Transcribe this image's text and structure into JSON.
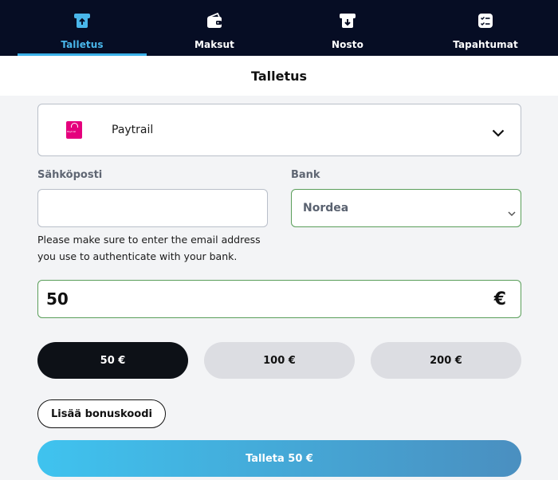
{
  "nav": {
    "tabs": [
      {
        "label": "Talletus",
        "icon": "deposit-icon",
        "active": true
      },
      {
        "label": "Maksut",
        "icon": "wallet-icon",
        "active": false
      },
      {
        "label": "Nosto",
        "icon": "withdraw-icon",
        "active": false
      },
      {
        "label": "Tapahtumat",
        "icon": "transactions-icon",
        "active": false
      }
    ]
  },
  "page": {
    "title": "Talletus"
  },
  "payment_method": {
    "name": "Paytrail",
    "logo_text": "Paytrail",
    "icon": "paytrail-logo"
  },
  "form": {
    "email_label": "Sähköposti",
    "email_value": "",
    "email_placeholder": "",
    "bank_label": "Bank",
    "bank_value": "Nordea",
    "hint": "Please make sure to enter the email address you use to authenticate with your bank.",
    "amount_value": "50",
    "currency_symbol": "€"
  },
  "quick_amounts": [
    "50 €",
    "100 €",
    "200 €"
  ],
  "bonus_button": "Lisää bonuskoodi",
  "submit_button": "Talleta 50 €",
  "colors": {
    "nav_bg": "#060d24",
    "accent": "#3ab0e8",
    "valid_border": "#5a9e5a",
    "selected_chip": "#0d1117",
    "paytrail_brand": "#e5007d"
  }
}
